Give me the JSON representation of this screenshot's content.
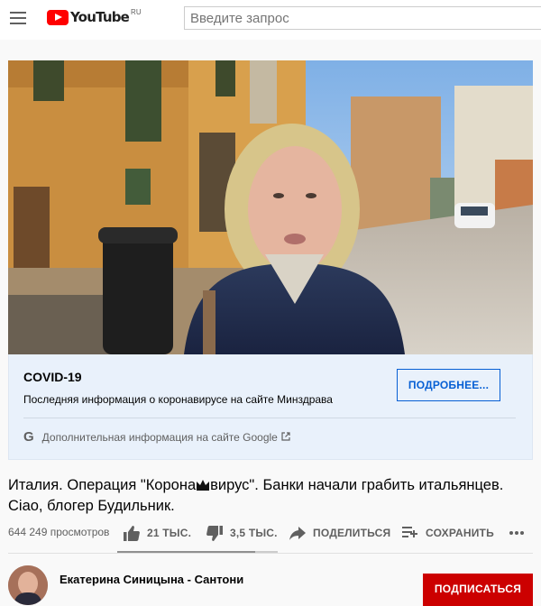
{
  "header": {
    "logo_text": "YouTube",
    "logo_region": "RU",
    "search_placeholder": "Введите запрос"
  },
  "info_panel": {
    "title": "COVID-19",
    "subtitle": "Последняя информация о коронавирусе на сайте Минздрава",
    "button_label": "ПОДРОБНЕЕ...",
    "google_link": "Дополнительная информация на сайте Google"
  },
  "video": {
    "title_part1": "Италия. Операция \"Корона",
    "title_part2": "вирус\". Банки начали грабить итальянцев. Ciao, блогер Будильник.",
    "views": "644 249 просмотров",
    "likes": "21 ТЫС.",
    "dislikes": "3,5 ТЫС.",
    "share_label": "ПОДЕЛИТЬСЯ",
    "save_label": "СОХРАНИТЬ",
    "sentiment_like_ratio": 0.86
  },
  "channel": {
    "name": "Екатерина Синицына - Сантони",
    "subscribe_label": "ПОДПИСАТЬСЯ"
  },
  "colors": {
    "brand_red": "#ff0000",
    "link_blue": "#065fd4",
    "subscribe_red": "#cc0000",
    "panel_bg": "#e9f1fb"
  },
  "icons": [
    "menu-icon",
    "youtube-logo",
    "google-icon",
    "external-link-icon",
    "crown-icon",
    "thumbs-up-icon",
    "thumbs-down-icon",
    "share-icon",
    "save-playlist-icon",
    "more-icon"
  ]
}
